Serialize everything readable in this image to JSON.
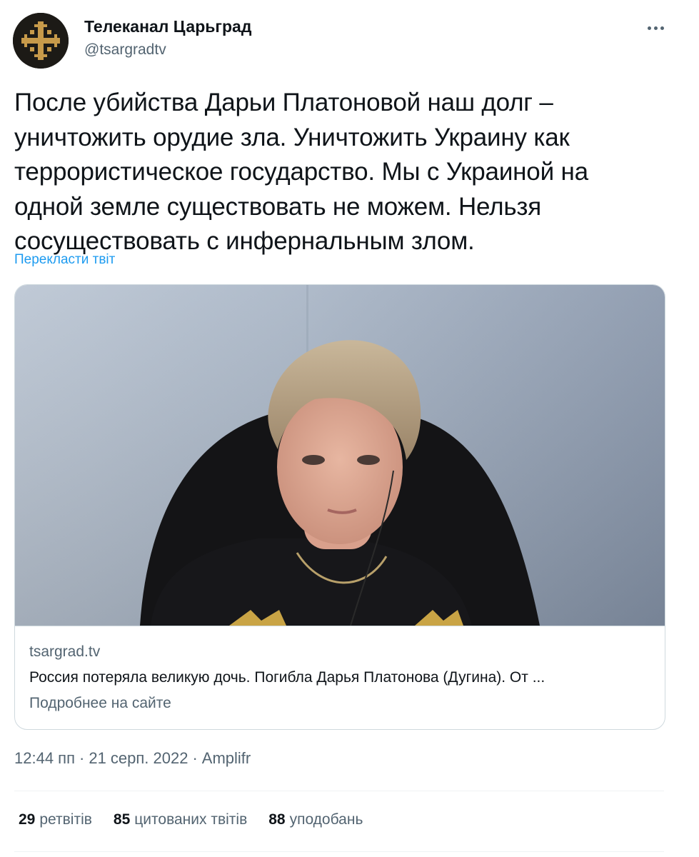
{
  "author": {
    "name": "Телеканал Царьград",
    "handle": "@tsargradtv",
    "avatar_icon": "cross-logo-icon"
  },
  "more_icon": "more-options-icon",
  "tweet": {
    "line1": "После убийства Дарьи Платоновой наш долг –",
    "line2": "уничтожить орудие зла. Уничтожить Украину как",
    "line3": "террористическое государство. Мы с Украиной на",
    "line4": "одной земле существовать не можем. Нельзя",
    "line5": "сосуществовать с инфернальным злом.",
    "translate_label": "Перекласти твіт"
  },
  "card": {
    "domain": "tsargrad.tv",
    "title": "Россия потеряла великую дочь. Погибла Дарья Платонова (Дугина). От ...",
    "more_label": "Подробнее на сайте"
  },
  "meta": {
    "time": "12:44 пп",
    "date": "21 серп. 2022",
    "source": "Amplifr"
  },
  "stats": {
    "retweets_count": "29",
    "retweets_label": "ретвітів",
    "quotes_count": "85",
    "quotes_label": "цитованих твітів",
    "likes_count": "88",
    "likes_label": "уподобань"
  },
  "colors": {
    "accent": "#1d9bf0",
    "muted": "#536471",
    "text": "#0f1419",
    "border": "#cfd9de"
  }
}
